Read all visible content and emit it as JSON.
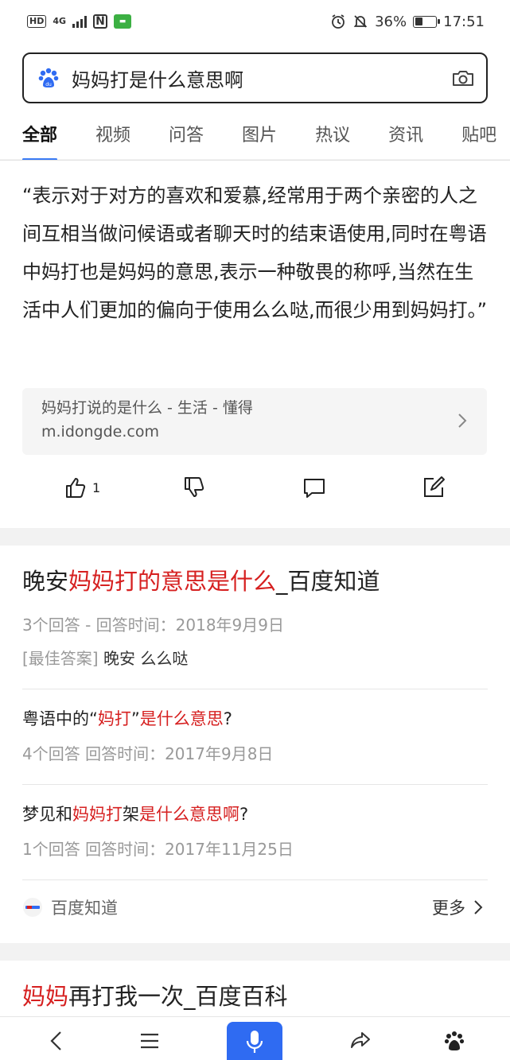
{
  "status_bar": {
    "hd_label": "HD",
    "network_label": "4G",
    "nfc_label": "N",
    "battery_percent": "36%",
    "battery_level": 0.36,
    "time": "17:51"
  },
  "search": {
    "query": "妈妈打是什么意思啊",
    "icon_left": "baidu-paw-icon",
    "icon_right": "camera-icon"
  },
  "tabs": [
    {
      "label": "全部",
      "active": true
    },
    {
      "label": "视频"
    },
    {
      "label": "问答"
    },
    {
      "label": "图片"
    },
    {
      "label": "热议"
    },
    {
      "label": "资讯"
    },
    {
      "label": "贴吧"
    }
  ],
  "result1": {
    "quote": "“表示对于对方的喜欢和爱慕,经常用于两个亲密的人之间互相当做问候语或者聊天时的结束语使用,同时在粤语中妈打也是妈妈的意思,表示一种敬畏的称呼,当然在生活中人们更加的偏向于使用么么哒,而很少用到妈妈打。”",
    "source_title": "妈妈打说的是什么 - 生活 - 懂得",
    "source_url": "m.idongde.com",
    "like_count": "1",
    "actions": [
      "thumbs-up-icon",
      "thumbs-down-icon",
      "comment-icon",
      "edit-icon"
    ]
  },
  "result2": {
    "title_pre": "晚安",
    "title_hl": "妈妈打的意思是什么",
    "title_post": "_百度知道",
    "meta": "3个回答 - 回答时间：2018年9月9日",
    "best_label": "[最佳答案]",
    "best_text": " 晚安 么么哒",
    "q1_a": "粤语中的“",
    "q1_b": "妈打",
    "q1_c": "”",
    "q1_d": "是什么意思",
    "q1_e": "?",
    "q1_meta": "4个回答   回答时间：2017年9月8日",
    "q2_a": "梦见和",
    "q2_b": "妈妈打",
    "q2_c": "架",
    "q2_d": "是什么意思啊",
    "q2_e": "?",
    "q2_meta": "1个回答   回答时间：2017年11月25日",
    "source_name": "百度知道",
    "more_label": "更多"
  },
  "result3": {
    "title_hl": "妈妈",
    "title_post": "再打我一次_百度百科"
  },
  "bottom_bar": [
    "back-icon",
    "menu-icon",
    "mic-icon",
    "share-icon",
    "baidu-home-icon"
  ],
  "colors": {
    "highlight": "#d62020",
    "accent": "#3a7bf5",
    "mic_button": "#2f6bf2"
  }
}
